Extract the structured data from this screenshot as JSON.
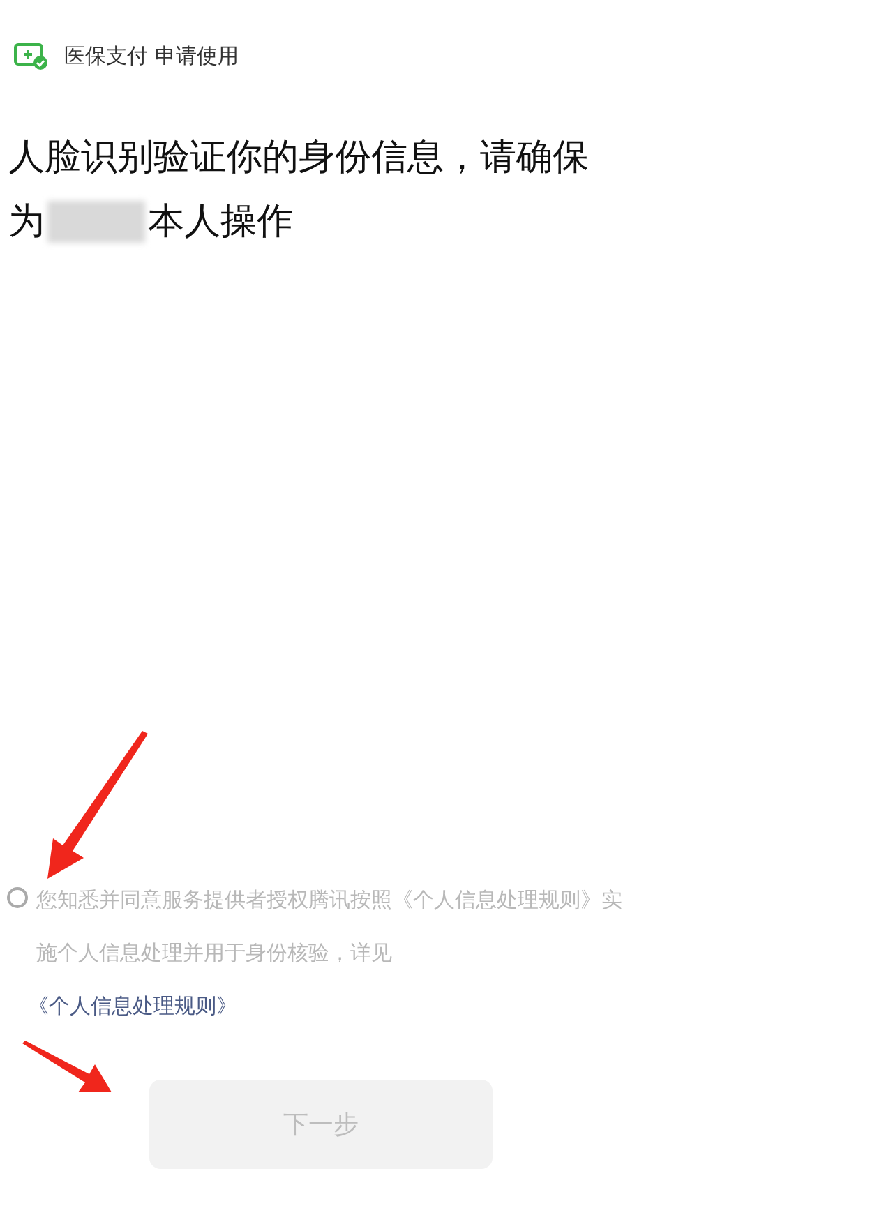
{
  "header": {
    "title": "医保支付 申请使用"
  },
  "heading": {
    "line_1": "人脸识别验证你的身份信息，请确保",
    "line_2_before": "为",
    "line_2_after": "本人操作"
  },
  "consent": {
    "checked": false,
    "text": "您知悉并同意服务提供者授权腾讯按照《个人信息处理规则》实施个人信息处理并用于身份核验，详见",
    "link": "《个人信息处理规则》"
  },
  "next_button": {
    "label": "下一步",
    "disabled": true
  }
}
